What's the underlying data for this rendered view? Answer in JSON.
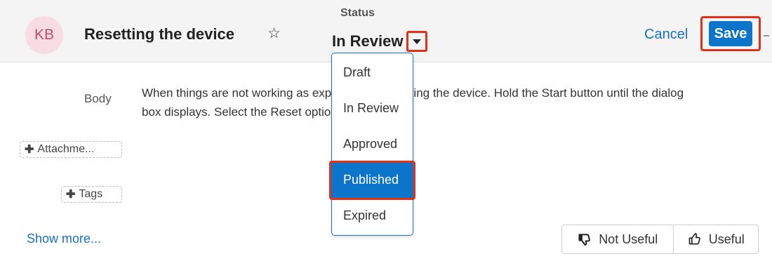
{
  "header": {
    "clipped_text": "",
    "avatar_initials": "KB",
    "title": "Resetting the device",
    "favorite_icon": "star-outline-icon",
    "status_label": "Status",
    "status_value": "In Review",
    "status_toggle_icon": "caret-down-icon",
    "cancel_label": "Cancel",
    "save_label": "Save"
  },
  "body": {
    "label": "Body",
    "text": "When things are not working as expected, try resetting the device. Hold the Start button until the dialog box displays. Select the Reset option."
  },
  "attachments": {
    "icon": "plus-icon",
    "label": "Attachme..."
  },
  "tags": {
    "icon": "plus-icon",
    "label": "Tags"
  },
  "show_more": "Show more...",
  "feedback": {
    "not_useful": {
      "icon": "thumbs-down-icon",
      "label": "Not Useful"
    },
    "useful": {
      "icon": "thumbs-up-icon",
      "label": "Useful"
    }
  },
  "status_dropdown": {
    "options": [
      "Draft",
      "In Review",
      "Approved",
      "Published",
      "Expired"
    ],
    "highlighted": "Published"
  },
  "colors": {
    "accent": "#0d75c9",
    "link": "#1a6fc7",
    "annotation": "#e0321b",
    "avatar_bg": "#f7dde3",
    "avatar_text": "#c04f6c",
    "header_bg": "#f4f4f4"
  }
}
